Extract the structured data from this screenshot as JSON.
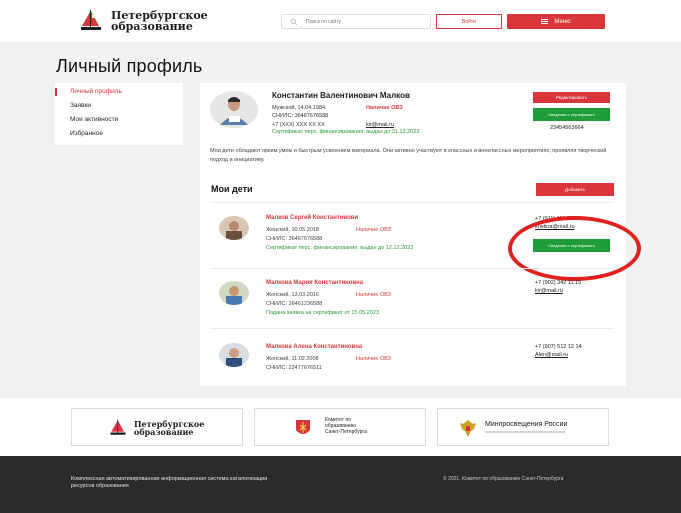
{
  "header": {
    "logo_line1": "Петербургское",
    "logo_line2": "образование",
    "search_placeholder": "Поиск по сайту",
    "login_label": "Войти",
    "menu_label": "Меню"
  },
  "page_title": "Личный профиль",
  "sidebar": {
    "items": [
      {
        "label": "Личный профиль",
        "active": true
      },
      {
        "label": "Заявки",
        "active": false
      },
      {
        "label": "Мои активности",
        "active": false
      },
      {
        "label": "Избранное",
        "active": false
      }
    ]
  },
  "profile": {
    "name": "Константин Валентинович Малков",
    "gender_dob": "Мужской, 14.04.1984",
    "snils": "СНИЛС: 36467676588",
    "phone": "+7 (XXX) XXX XX XX",
    "email": "kir@mail.ru",
    "nalichie": "Наличие ОВЗ",
    "certificate": "Сертификат перс. финансирования:  выдан до 31.12.2023",
    "edit_button": "Редактировать",
    "cert_button": "Сведения о сертификате",
    "id_number": "23454563664",
    "description": "Мои дети обладают ярким умом и быстрым усвоением материала. Они активно участвуют в классных и внеклассных мероприятиях, проявляя творческий подход и инициативу."
  },
  "children": {
    "title": "Мои дети",
    "add_button": "Добавить",
    "items": [
      {
        "name": "Малков Сергей Константинови",
        "gender_dob": "Женский, 30.05.2018",
        "snils": "СНИЛС: 36467676588",
        "nalichie": "Наличие ОВЗ",
        "status": "Сертификат перс. финансирования:  выдан до 12.12.2023",
        "phone": "+7 (911) 111 23 52",
        "email": "kristina@mail.ru",
        "cert_button": "Сведения о сертификате"
      },
      {
        "name": "Малкова Мария Константиновна",
        "gender_dob": "Женский, 13.03.2016",
        "snils": "СНИЛС: 36461236588",
        "nalichie": "Наличие ОВЗ",
        "status": "Подана заявка на сертификат от 15.05.2023",
        "phone": "+7 (902) 342 11 15",
        "email": "kir@mail.ru"
      },
      {
        "name": "Малкова Алена Константиновна",
        "gender_dob": "Женский, 11.02.2008",
        "snils": "СНИЛС: 22477676511",
        "nalichie": "Наличие ОВЗ",
        "status": "",
        "phone": "+7 (907) 512 12 14",
        "email": "Alen@mail.ru"
      }
    ]
  },
  "partners": {
    "p1_line1": "Петербургское",
    "p1_line2": "образование",
    "p2_line1": "Комитет по",
    "p2_line2": "образованию",
    "p2_line3": "Санкт-Петербурга",
    "p3_title": "Минпросвещения России"
  },
  "footer": {
    "left_text": "Комплексная автоматизированная информационная система каталогизации ресурсов образования",
    "copyright": "© 2021. Комитет по образованию Санкт-Петербурга"
  },
  "colors": {
    "accent": "#d8363a",
    "green": "#1f9b37",
    "footer_bg": "#2b2b2b"
  }
}
